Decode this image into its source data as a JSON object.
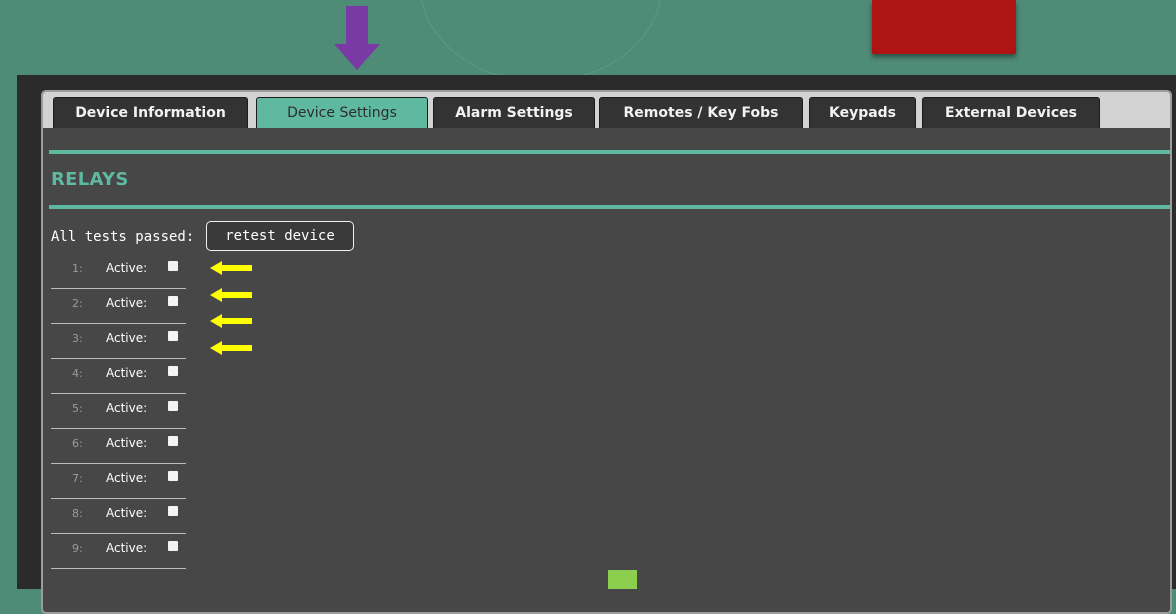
{
  "tabs": [
    {
      "label": "Device Information",
      "active": false
    },
    {
      "label": "Device Settings",
      "active": true
    },
    {
      "label": "Alarm Settings",
      "active": false
    },
    {
      "label": "Remotes / Key Fobs",
      "active": false
    },
    {
      "label": "Keypads",
      "active": false
    },
    {
      "label": "External Devices",
      "active": false
    }
  ],
  "section": {
    "title": "RELAYS"
  },
  "tests": {
    "status_label": "All tests passed:",
    "retest_label": "retest device"
  },
  "relays": [
    {
      "number": "1:",
      "label": "Active:",
      "checked": false
    },
    {
      "number": "2:",
      "label": "Active:",
      "checked": false
    },
    {
      "number": "3:",
      "label": "Active:",
      "checked": false
    },
    {
      "number": "4:",
      "label": "Active:",
      "checked": false
    },
    {
      "number": "5:",
      "label": "Active:",
      "checked": false
    },
    {
      "number": "6:",
      "label": "Active:",
      "checked": false
    },
    {
      "number": "7:",
      "label": "Active:",
      "checked": false
    },
    {
      "number": "8:",
      "label": "Active:",
      "checked": false
    },
    {
      "number": "9:",
      "label": "Active:",
      "checked": false
    }
  ],
  "annotations": {
    "down_arrow": {
      "icon": "arrow-down-icon",
      "color": "#7a3aa5"
    },
    "pointer_arrows": {
      "icon": "arrow-left-icon",
      "color": "#ffff00",
      "count": 4
    },
    "red_marker_color": "#ae1414",
    "green_marker_color": "#8ccf4e"
  },
  "colors": {
    "background": "#4e8c78",
    "accent": "#5fb9a0",
    "panel": "#474747",
    "frame": "#2b2b2b"
  }
}
